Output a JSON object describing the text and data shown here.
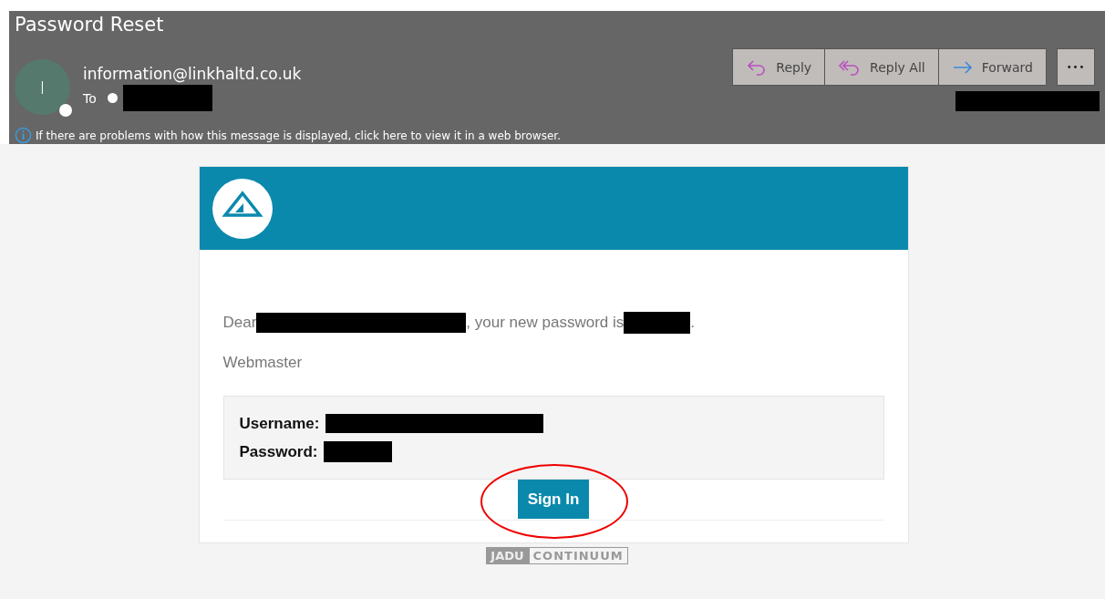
{
  "message": {
    "subject": "Password Reset",
    "avatar_initial": "I",
    "sender": "information@linkhaltd.co.uk",
    "to_label": "To",
    "info_notice": "If there are problems with how this message is displayed, click here to view it in a web browser."
  },
  "actions": [
    {
      "kind": "reply",
      "label": "Reply"
    },
    {
      "kind": "reply-all",
      "label": "Reply All"
    },
    {
      "kind": "forward",
      "label": "Forward"
    },
    {
      "kind": "more",
      "label": "•••"
    }
  ],
  "email": {
    "greeting": [
      {
        "kind": "text",
        "text": "Dear"
      },
      {
        "kind": "redaction-long"
      },
      {
        "kind": "text",
        "text": ", your new password is"
      },
      {
        "kind": "redaction-short"
      },
      {
        "kind": "text",
        "text": "."
      }
    ],
    "signature": "Webmaster",
    "credentials": [
      {
        "label": "Username:",
        "value": {
          "kind": "redaction-long"
        }
      },
      {
        "label": "Password:",
        "value": {
          "kind": "redaction-short"
        }
      }
    ],
    "button": "Sign In",
    "button_circled": true
  },
  "footer_logo": {
    "left": "JADU",
    "right": "CONTINUUM"
  }
}
